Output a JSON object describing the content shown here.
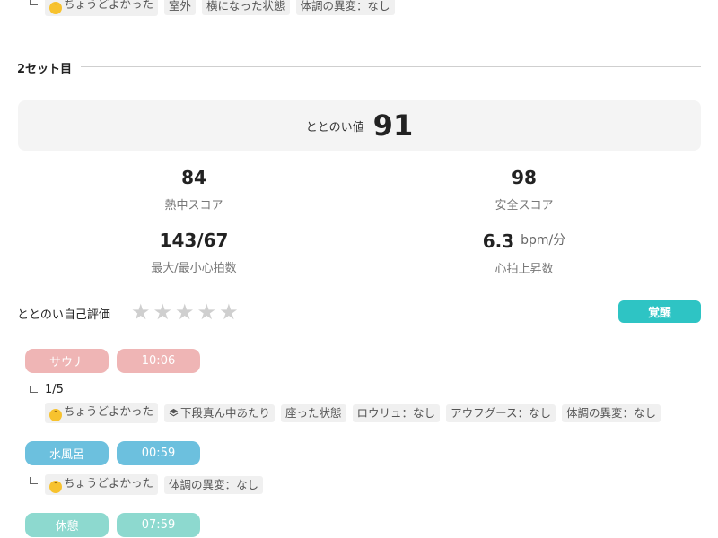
{
  "top_row": {
    "tags": [
      "ちょうどよかった",
      "室外",
      "横になった状態",
      "体調の異変：なし"
    ]
  },
  "section": {
    "title": "2セット目"
  },
  "totonoi": {
    "label": "ととのい値",
    "value": "91"
  },
  "stats": [
    {
      "value": "84",
      "unit": "",
      "label": "熱中スコア"
    },
    {
      "value": "98",
      "unit": "",
      "label": "安全スコア"
    },
    {
      "value": "143/67",
      "unit": "",
      "label": "最大/最小心拍数"
    },
    {
      "value": "6.3",
      "unit": "bpm/分",
      "label": "心拍上昇数"
    }
  ],
  "self_rating": {
    "label": "ととのい自己評価",
    "stars_filled": 0,
    "stars_total": 5,
    "badge": "覚醒"
  },
  "phases": [
    {
      "name": "サウナ",
      "time": "10:06",
      "color": "#efb5b5",
      "count": "1/5",
      "tags": [
        "ちょうどよかった",
        "下段真ん中あたり",
        "座った状態",
        "ロウリュ：なし",
        "アウフグース：なし",
        "体調の異変：なし"
      ]
    },
    {
      "name": "水風呂",
      "time": "00:59",
      "color": "#6cc0de",
      "tags": [
        "ちょうどよかった",
        "体調の異変：なし"
      ]
    },
    {
      "name": "休憩",
      "time": "07:59",
      "color": "#8dd9cf"
    }
  ],
  "colors": {
    "sauna": "#efb5b5",
    "water": "#6cc0de",
    "rest": "#8dd9cf",
    "badge": "#2ec4c4"
  },
  "icons": {
    "mood": "smile-emoji-icon",
    "position": "layers-icon",
    "branch": "corner-branch-icon"
  }
}
